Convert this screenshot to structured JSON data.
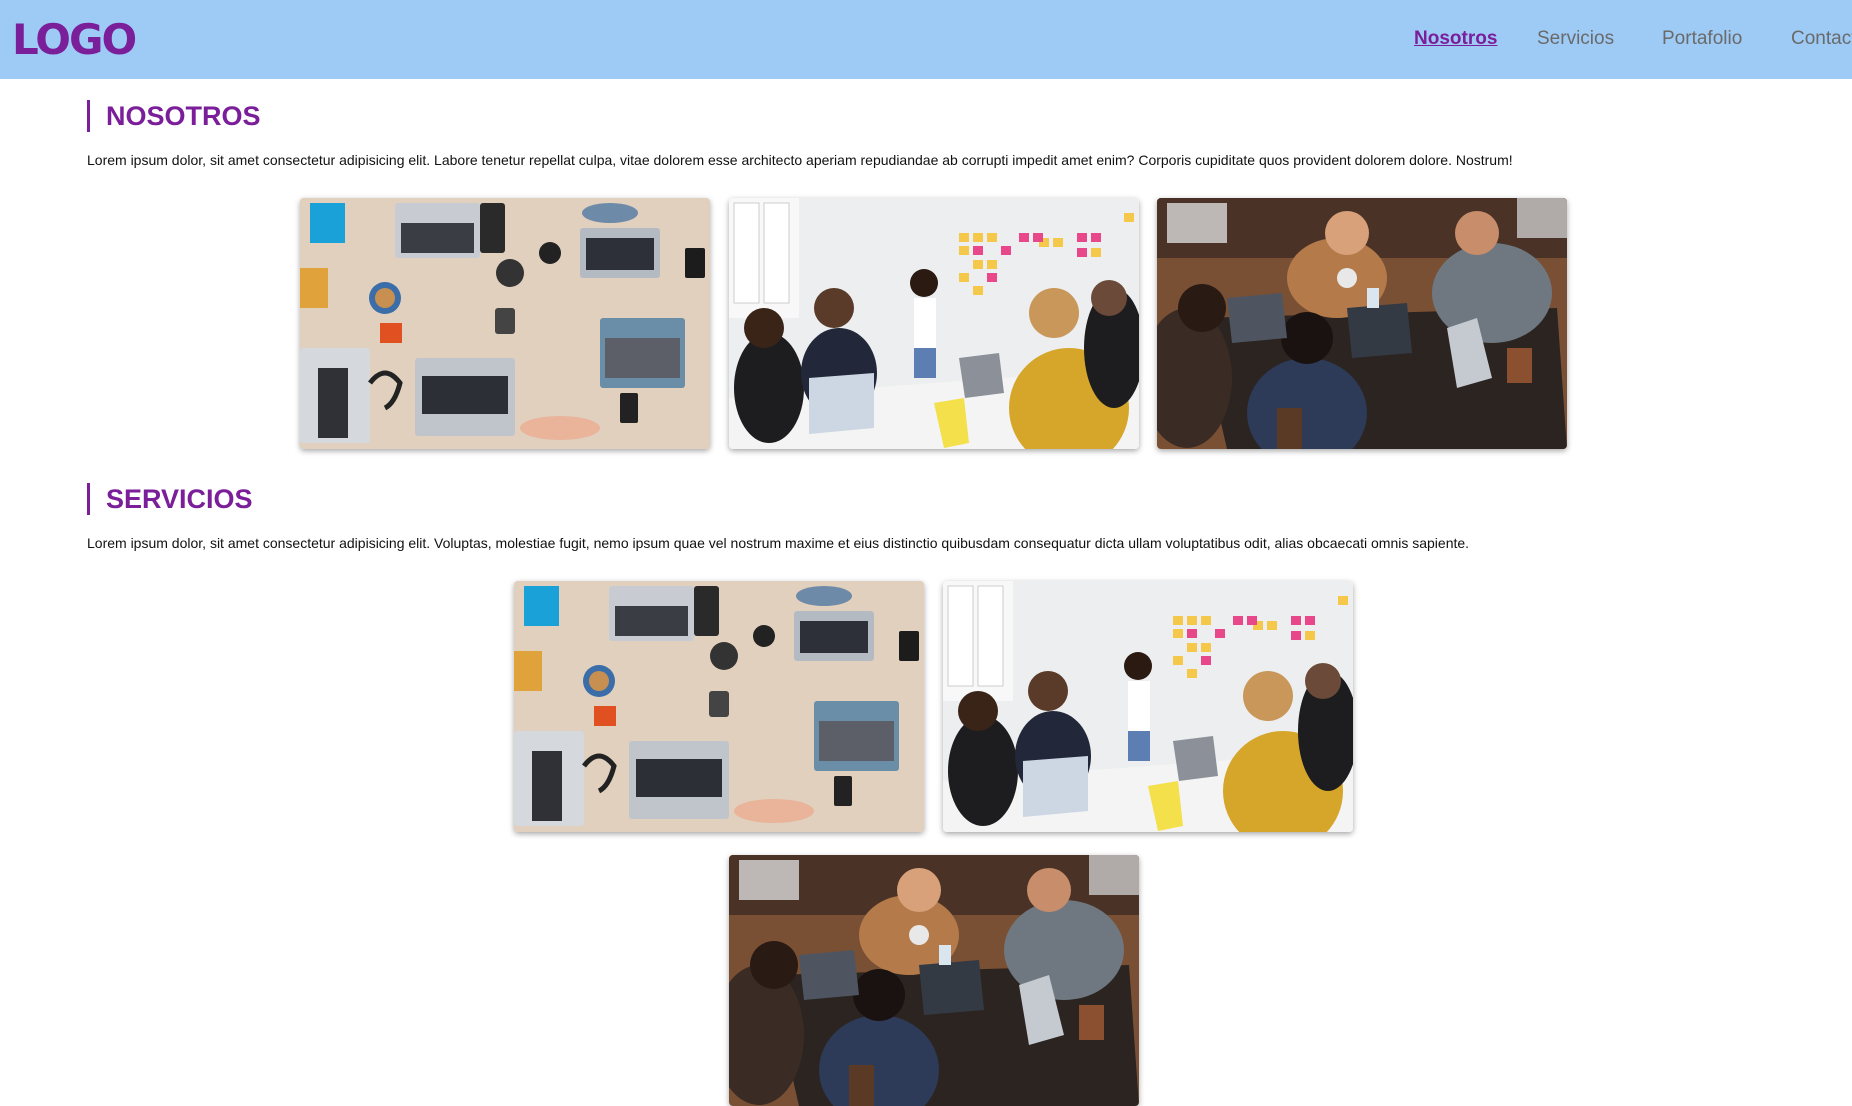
{
  "header": {
    "logo": "LOGO",
    "nav": [
      {
        "label": "Nosotros",
        "active": true
      },
      {
        "label": "Servicios",
        "active": false
      },
      {
        "label": "Portafolio",
        "active": false
      },
      {
        "label": "Contacto",
        "active": false
      }
    ]
  },
  "sections": [
    {
      "title": "NOSOTROS",
      "text": "Lorem ipsum dolor, sit amet consectetur adipisicing elit. Labore tenetur repellat culpa, vitae dolorem esse architecto aperiam repudiandae ab corrupti impedit amet enim? Corporis cupiditate quos provident dolorem dolore. Nostrum!",
      "images": [
        "laptops-desk-photo",
        "sticky-notes-meeting-photo",
        "team-coding-photo"
      ]
    },
    {
      "title": "SERVICIOS",
      "text": "Lorem ipsum dolor, sit amet consectetur adipisicing elit. Voluptas, molestiae fugit, nemo ipsum quae vel nostrum maxime et eius distinctio quibusdam consequatur dicta ullam voluptatibus odit, alias obcaecati omnis sapiente.",
      "images": [
        "laptops-desk-photo",
        "sticky-notes-meeting-photo",
        "team-coding-photo"
      ]
    }
  ],
  "colors": {
    "header_bg": "#9ecbf6",
    "accent": "#7a1e9a",
    "nav_text": "#6a6a6a"
  }
}
